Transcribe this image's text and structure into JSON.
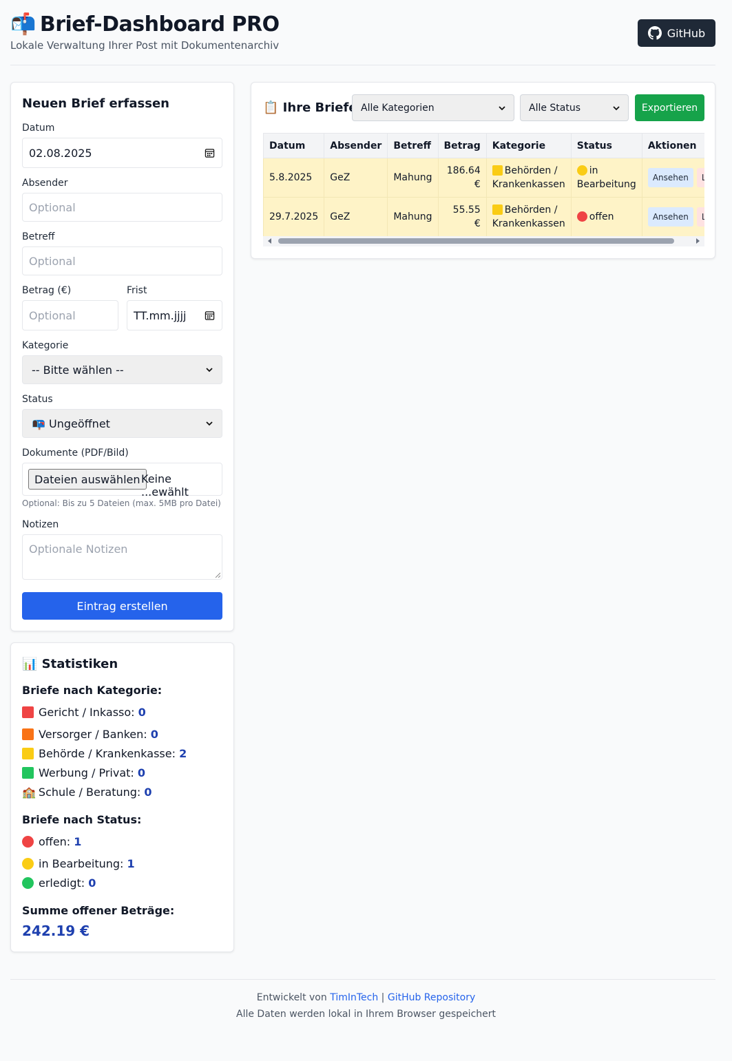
{
  "header": {
    "logo_emoji": "📬",
    "title": "Brief-Dashboard PRO",
    "subtitle": "Lokale Verwaltung Ihrer Post mit Dokumentenarchiv",
    "github_label": "GitHub"
  },
  "form": {
    "title": "Neuen Brief erfassen",
    "date_label": "Datum",
    "date_value": "02.08.2025",
    "sender_label": "Absender",
    "sender_placeholder": "Optional",
    "subject_label": "Betreff",
    "subject_placeholder": "Optional",
    "amount_label": "Betrag (€)",
    "amount_placeholder": "Optional",
    "deadline_label": "Frist",
    "deadline_value": "TT.mm.jjjj",
    "category_label": "Kategorie",
    "category_selected": "-- Bitte wählen --",
    "status_label": "Status",
    "status_selected": "📭 Ungeöffnet",
    "documents_label": "Dokumente (PDF/Bild)",
    "file_button": "Dateien auswählen",
    "file_status": "Keine ...ewählt",
    "file_hint": "Optional: Bis zu 5 Dateien (max. 5MB pro Datei)",
    "notes_label": "Notizen",
    "notes_placeholder": "Optionale Notizen",
    "submit_label": "Eintrag erstellen"
  },
  "stats": {
    "title": "📊 Statistiken",
    "by_category_heading": "Briefe nach Kategorie:",
    "categories": [
      {
        "label": "Gericht / Inkasso:",
        "count": "0",
        "color": "#ef4444"
      },
      {
        "label": "Versorger / Banken:",
        "count": "0",
        "color": "#f97316"
      },
      {
        "label": "Behörde / Krankenkasse:",
        "count": "2",
        "color": "#facc15"
      },
      {
        "label": "Werbung / Privat:",
        "count": "0",
        "color": "#22c55e"
      },
      {
        "label": "Schule / Beratung:",
        "count": "0",
        "icon": "🏫"
      }
    ],
    "by_status_heading": "Briefe nach Status:",
    "statuses": [
      {
        "label": "offen:",
        "count": "1",
        "color": "#ef4444"
      },
      {
        "label": "in Bearbeitung:",
        "count": "1",
        "color": "#facc15"
      },
      {
        "label": "erledigt:",
        "count": "0",
        "color": "#22c55e"
      }
    ],
    "sum_heading": "Summe offener Beträge:",
    "sum_value": "242.19 €"
  },
  "letters": {
    "title": "📋 Ihre Briefe",
    "filter_category": "Alle Kategorien",
    "filter_status": "Alle Status",
    "export_label": "Exportieren",
    "columns": [
      "Datum",
      "Absender",
      "Betreff",
      "Betrag",
      "Kategorie",
      "Status",
      "Aktionen"
    ],
    "rows": [
      {
        "date": "5.8.2025",
        "sender": "GeZ",
        "subject": "Mahung",
        "amount": "186.64 €",
        "category": "Behörden / Krankenkassen",
        "category_color": "#facc15",
        "status": "in Bearbeitung",
        "status_color": "#facc15",
        "view_label": "Ansehen",
        "delete_label": "Löschen"
      },
      {
        "date": "29.7.2025",
        "sender": "GeZ",
        "subject": "Mahung",
        "amount": "55.55 €",
        "category": "Behörden / Krankenkassen",
        "category_color": "#facc15",
        "status": "offen",
        "status_color": "#ef4444",
        "view_label": "Ansehen",
        "delete_label": "Löschen"
      }
    ]
  },
  "footer": {
    "developed_by": "Entwickelt von",
    "author_link": "TimInTech",
    "separator": "|",
    "repo_link": "GitHub Repository",
    "storage_note": "Alle Daten werden lokal in Ihrem Browser gespeichert"
  },
  "colors": {
    "primary": "#2563eb",
    "export": "#16a34a",
    "row_highlight": "#fef3c7",
    "github_bg": "#1f2937"
  }
}
